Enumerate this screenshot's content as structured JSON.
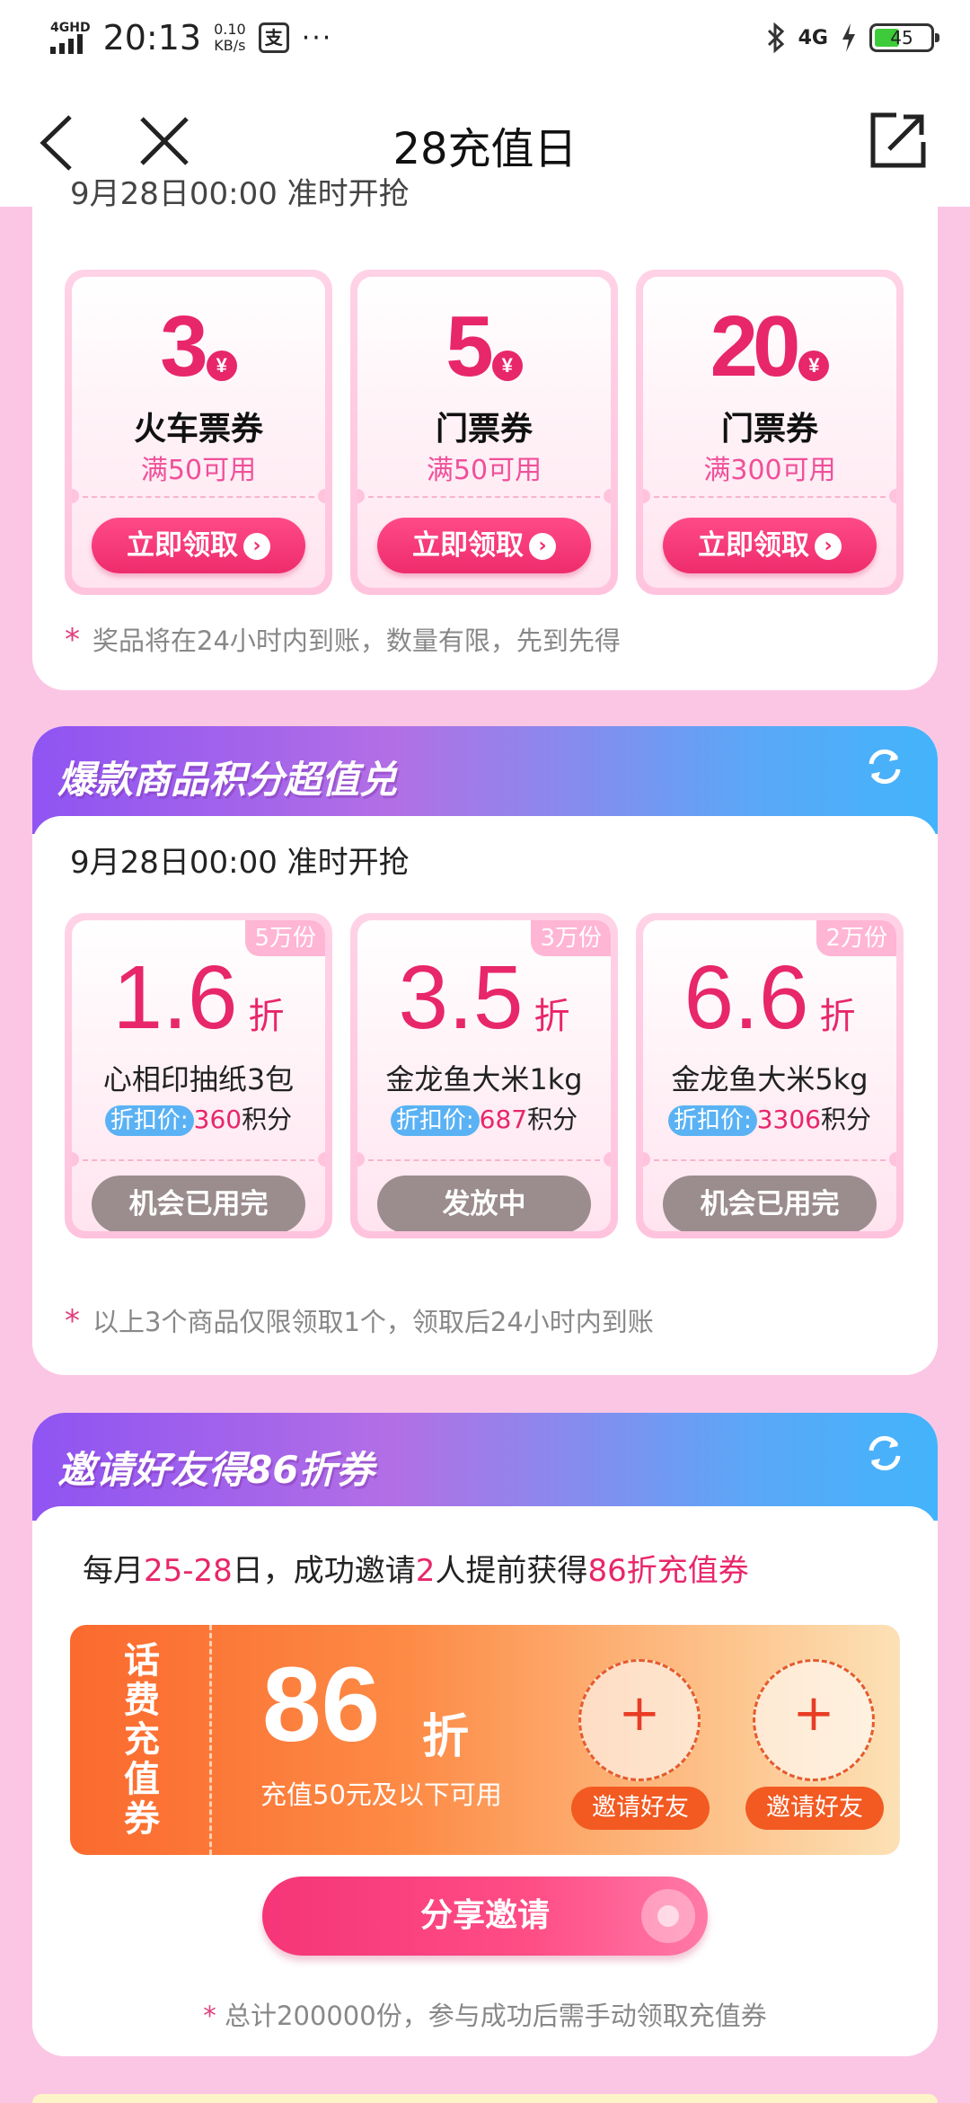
{
  "status_bar": {
    "network": "4GHD",
    "time": "20:13",
    "speed_value": "0.10",
    "speed_unit": "KB/s",
    "app_icon": "支",
    "more": "···",
    "net_right": "4G",
    "battery": "45"
  },
  "nav": {
    "title": "28充值日"
  },
  "coupons_section": {
    "date_line": "9月28日00:00 准时开抢",
    "coupons": [
      {
        "amount": "3",
        "currency": "¥",
        "name": "火车票券",
        "condition": "满50可用",
        "button": "立即领取"
      },
      {
        "amount": "5",
        "currency": "¥",
        "name": "门票券",
        "condition": "满50可用",
        "button": "立即领取"
      },
      {
        "amount": "20",
        "currency": "¥",
        "name": "门票券",
        "condition": "满300可用",
        "button": "立即领取"
      }
    ],
    "note": "奖品将在24小时内到账，数量有限，先到先得"
  },
  "points_section": {
    "title": "爆款商品积分超值兑",
    "date_line": "9月28日00:00 准时开抢",
    "products": [
      {
        "qty": "5万份",
        "discount": "1.6",
        "unit": "折",
        "name": "心相印抽纸3包",
        "price_tag": "折扣价:",
        "points": "360",
        "points_unit": "积分",
        "button": "机会已用完"
      },
      {
        "qty": "3万份",
        "discount": "3.5",
        "unit": "折",
        "name": "金龙鱼大米1kg",
        "price_tag": "折扣价:",
        "points": "687",
        "points_unit": "积分",
        "button": "发放中"
      },
      {
        "qty": "2万份",
        "discount": "6.6",
        "unit": "折",
        "name": "金龙鱼大米5kg",
        "price_tag": "折扣价:",
        "points": "3306",
        "points_unit": "积分",
        "button": "机会已用完"
      }
    ],
    "note": "以上3个商品仅限领取1个，领取后24小时内到账"
  },
  "invite_section": {
    "title": "邀请好友得86折券",
    "line_parts": [
      "每月",
      "25-28",
      "日，成功邀请",
      "2",
      "人提前获得",
      "86折充值券"
    ],
    "ticket": {
      "stub": "话费充值券",
      "number": "86",
      "unit": "折",
      "condition": "充值50元及以下可用",
      "slots": [
        "邀请好友",
        "邀请好友"
      ],
      "plus": "+"
    },
    "share_button": "分享邀请",
    "note": "总计200000份，参与成功后需手动领取充值券"
  },
  "colors": {
    "accent": "#e8266a",
    "background": "#fbc6e4",
    "header_gradient_start": "#8f54f2",
    "header_gradient_end": "#42b4fb"
  }
}
